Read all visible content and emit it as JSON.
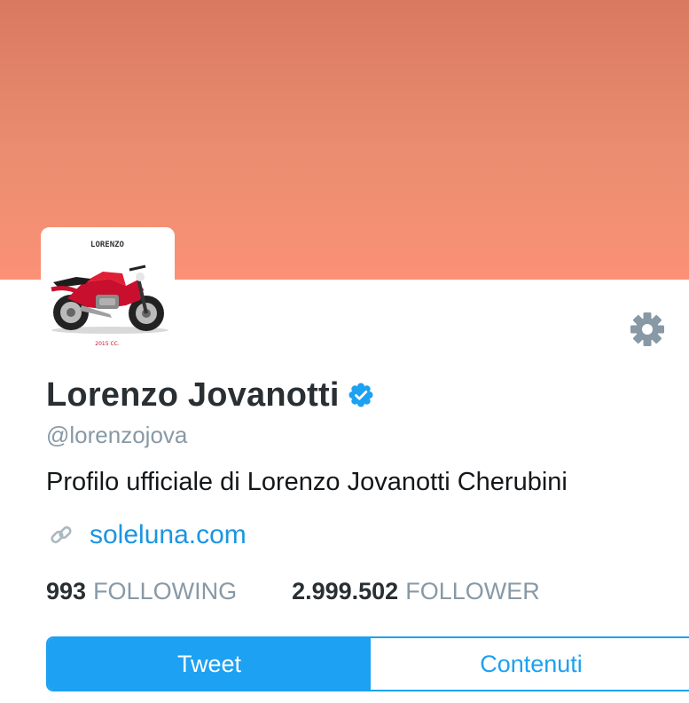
{
  "profile": {
    "banner_color": "#f08a6e",
    "avatar": {
      "brand_text": "LORENZO",
      "caption_text": "2015 CC.",
      "depicts": "red motorcycle"
    },
    "name": "Lorenzo Jovanotti",
    "verified": true,
    "handle": "@lorenzojova",
    "bio": "Profilo ufficiale di Lorenzo Jovanotti Cherubini",
    "website": "soleluna.com",
    "stats": {
      "following_count": "993",
      "following_label": "FOLLOWING",
      "follower_count": "2.999.502",
      "follower_label": "FOLLOWER"
    }
  },
  "tabs": [
    {
      "label": "Tweet",
      "active": true
    },
    {
      "label": "Contenuti",
      "active": false
    }
  ],
  "icons": {
    "settings": "gear-icon",
    "verified": "verified-badge-icon",
    "link": "link-icon"
  },
  "colors": {
    "accent": "#1da1f2",
    "link": "#1b95e0",
    "muted": "#8899a6",
    "verified": "#1da1f2"
  }
}
